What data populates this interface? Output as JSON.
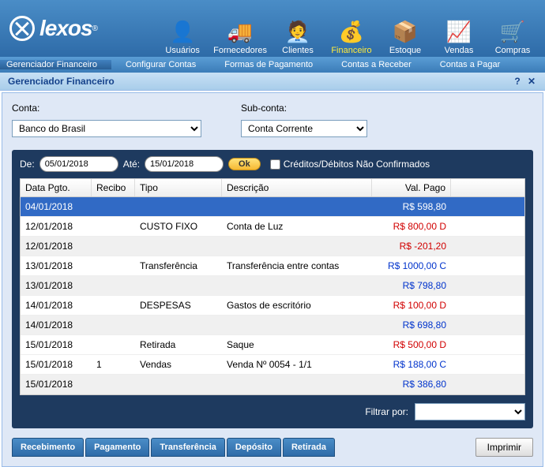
{
  "brand": "lexos",
  "nav": [
    {
      "label": "Usuários",
      "icon": "👤"
    },
    {
      "label": "Fornecedores",
      "icon": "🚚"
    },
    {
      "label": "Clientes",
      "icon": "🧑‍💼"
    },
    {
      "label": "Financeiro",
      "icon": "💰",
      "active": true
    },
    {
      "label": "Estoque",
      "icon": "📦"
    },
    {
      "label": "Vendas",
      "icon": "📈"
    },
    {
      "label": "Compras",
      "icon": "🛒"
    }
  ],
  "subnav": [
    "Gerenciador Financeiro",
    "Configurar Contas",
    "Formas de Pagamento",
    "Contas a Receber",
    "Contas a Pagar"
  ],
  "panel": {
    "title": "Gerenciador Financeiro"
  },
  "filters": {
    "conta_label": "Conta:",
    "conta_value": "Banco do Brasil",
    "subconta_label": "Sub-conta:",
    "subconta_value": "Conta Corrente"
  },
  "dates": {
    "de_label": "De:",
    "de_value": "05/01/2018",
    "ate_label": "Até:",
    "ate_value": "15/01/2018",
    "ok": "Ok",
    "chk_label": "Créditos/Débitos Não Confirmados"
  },
  "grid": {
    "headers": {
      "data": "Data Pgto.",
      "recibo": "Recibo",
      "tipo": "Tipo",
      "desc": "Descrição",
      "val": "Val. Pago"
    },
    "rows": [
      {
        "data": "04/01/2018",
        "recibo": "",
        "tipo": "",
        "desc": "",
        "val": "R$ 598,80",
        "cls": "val-b",
        "sel": true
      },
      {
        "data": "12/01/2018",
        "recibo": "",
        "tipo": "CUSTO FIXO",
        "desc": "Conta de Luz",
        "val": "R$ 800,00 D",
        "cls": "val-d"
      },
      {
        "data": "12/01/2018",
        "recibo": "",
        "tipo": "",
        "desc": "",
        "val": "R$ -201,20",
        "cls": "val-d",
        "odd": true
      },
      {
        "data": "13/01/2018",
        "recibo": "",
        "tipo": "Transferência",
        "desc": "Transferência entre contas",
        "val": "R$ 1000,00 C",
        "cls": "val-c"
      },
      {
        "data": "13/01/2018",
        "recibo": "",
        "tipo": "",
        "desc": "",
        "val": "R$ 798,80",
        "cls": "val-b",
        "odd": true
      },
      {
        "data": "14/01/2018",
        "recibo": "",
        "tipo": "DESPESAS",
        "desc": "Gastos de escritório",
        "val": "R$ 100,00 D",
        "cls": "val-d"
      },
      {
        "data": "14/01/2018",
        "recibo": "",
        "tipo": "",
        "desc": "",
        "val": "R$ 698,80",
        "cls": "val-b",
        "odd": true
      },
      {
        "data": "15/01/2018",
        "recibo": "",
        "tipo": "Retirada",
        "desc": "Saque",
        "val": "R$ 500,00 D",
        "cls": "val-d"
      },
      {
        "data": "15/01/2018",
        "recibo": "1",
        "tipo": "Vendas",
        "desc": "Venda Nº 0054 - 1/1",
        "val": "R$ 188,00 C",
        "cls": "val-c"
      },
      {
        "data": "15/01/2018",
        "recibo": "",
        "tipo": "",
        "desc": "",
        "val": "R$ 386,80",
        "cls": "val-b",
        "odd": true
      }
    ]
  },
  "filter_bar": {
    "label": "Filtrar por:",
    "value": ""
  },
  "tabs": [
    "Recebimento",
    "Pagamento",
    "Transferência",
    "Depósito",
    "Retirada"
  ],
  "print": "Imprimir"
}
